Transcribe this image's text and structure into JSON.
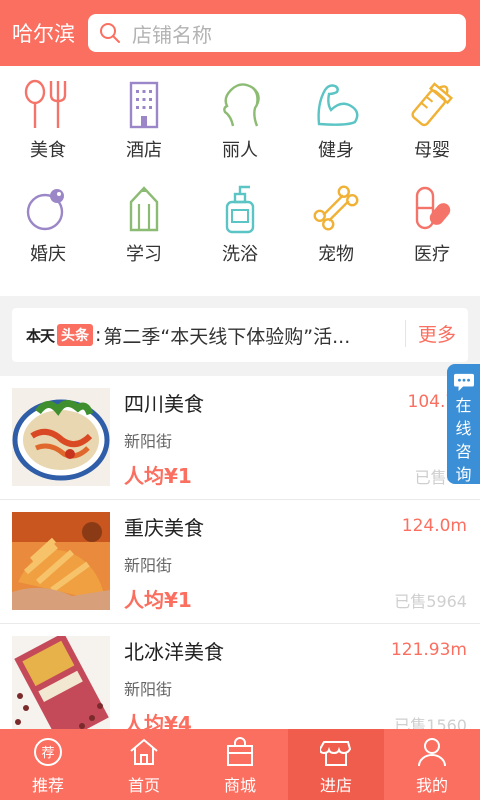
{
  "header": {
    "city": "哈尔滨",
    "search_placeholder": "店铺名称"
  },
  "categories": [
    {
      "label": "美食",
      "icon": "cutlery-icon"
    },
    {
      "label": "酒店",
      "icon": "hotel-building-icon"
    },
    {
      "label": "丽人",
      "icon": "beauty-face-icon"
    },
    {
      "label": "健身",
      "icon": "muscle-arm-icon"
    },
    {
      "label": "母婴",
      "icon": "baby-bottle-icon"
    },
    {
      "label": "婚庆",
      "icon": "wedding-icon"
    },
    {
      "label": "学习",
      "icon": "pencil-icon"
    },
    {
      "label": "洗浴",
      "icon": "soap-bottle-icon"
    },
    {
      "label": "宠物",
      "icon": "bone-icon"
    },
    {
      "label": "医疗",
      "icon": "medicine-pill-icon"
    }
  ],
  "notice": {
    "brand_left": "本天",
    "brand_right": "头条",
    "sep": ":",
    "text": "第二季“本天线下体验购”活...",
    "more": "更多"
  },
  "shops": [
    {
      "name": "四川美食",
      "street": "新阳街",
      "avg": "人均¥1",
      "distance": "104.73",
      "sold": "已售46"
    },
    {
      "name": "重庆美食",
      "street": "新阳街",
      "avg": "人均¥1",
      "distance": "124.0m",
      "sold": "已售5964"
    },
    {
      "name": "北冰洋美食",
      "street": "新阳街",
      "avg": "人均¥4",
      "distance": "121.93m",
      "sold": "已售1560"
    }
  ],
  "consult": {
    "chars": [
      "在",
      "线",
      "咨",
      "询"
    ]
  },
  "nav": [
    {
      "label": "推荐",
      "icon": "recommend-icon"
    },
    {
      "label": "首页",
      "icon": "home-icon"
    },
    {
      "label": "商城",
      "icon": "shopping-bag-icon"
    },
    {
      "label": "进店",
      "icon": "store-icon",
      "active": true
    },
    {
      "label": "我的",
      "icon": "user-icon"
    }
  ],
  "colors": {
    "accent": "#fb6f60",
    "consult": "#3a8fd6"
  }
}
